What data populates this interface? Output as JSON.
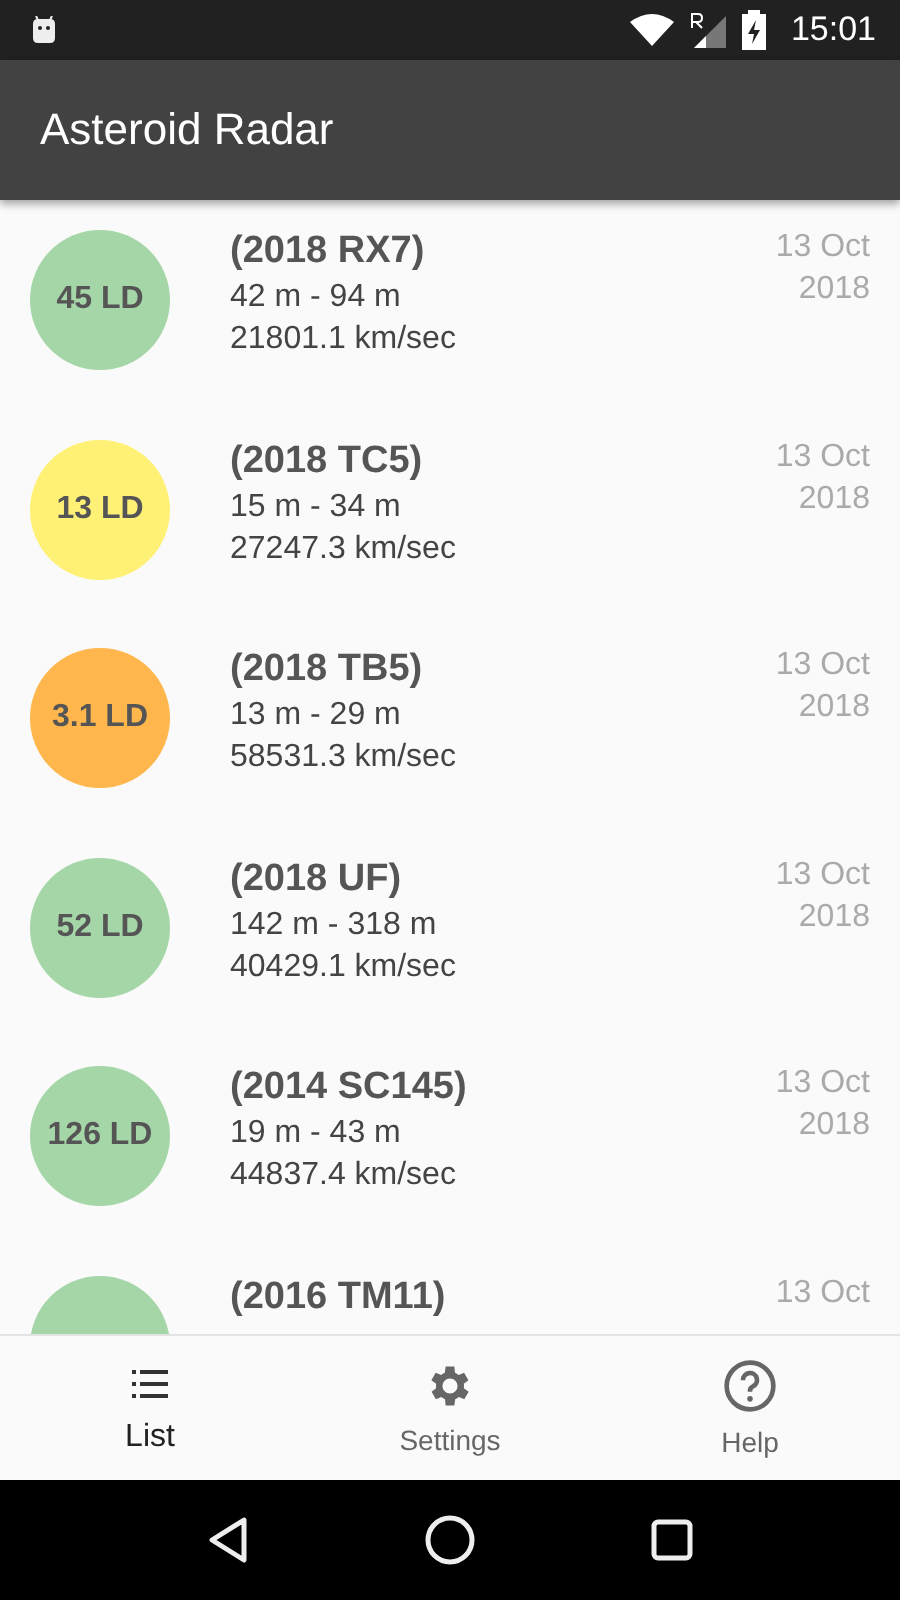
{
  "status_bar": {
    "time": "15:01"
  },
  "app_bar": {
    "title": "Asteroid Radar"
  },
  "asteroids": [
    {
      "distance": "45 LD",
      "color": "#a5d6a7",
      "name": "(2018 RX7)",
      "size": "42 m - 94 m",
      "velocity": "21801.1 km/sec",
      "date": "13 Oct",
      "year": "2018"
    },
    {
      "distance": "13 LD",
      "color": "#fff176",
      "name": "(2018 TC5)",
      "size": "15 m - 34 m",
      "velocity": "27247.3 km/sec",
      "date": "13 Oct",
      "year": "2018"
    },
    {
      "distance": "3.1 LD",
      "color": "#ffb74d",
      "name": "(2018 TB5)",
      "size": "13 m - 29 m",
      "velocity": "58531.3 km/sec",
      "date": "13 Oct",
      "year": "2018"
    },
    {
      "distance": "52 LD",
      "color": "#a5d6a7",
      "name": "(2018 UF)",
      "size": "142 m - 318 m",
      "velocity": "40429.1 km/sec",
      "date": "13 Oct",
      "year": "2018"
    },
    {
      "distance": "126 LD",
      "color": "#a5d6a7",
      "name": "(2014 SC145)",
      "size": "19 m - 43 m",
      "velocity": "44837.4 km/sec",
      "date": "13 Oct",
      "year": "2018"
    },
    {
      "color": "#a5d6a7",
      "name": "(2016 TM11)",
      "date": "13 Oct"
    }
  ],
  "bottom_nav": [
    {
      "kind": "list",
      "label": "List",
      "selected": true
    },
    {
      "kind": "settings",
      "label": "Settings",
      "selected": false
    },
    {
      "kind": "help",
      "label": "Help",
      "selected": false
    }
  ]
}
